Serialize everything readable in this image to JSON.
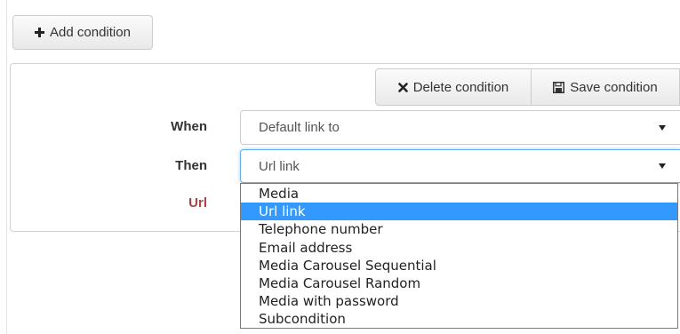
{
  "toolbar": {
    "add_condition_label": "Add condition"
  },
  "condition": {
    "delete_label": "Delete condition",
    "save_label": "Save condition",
    "when": {
      "label": "When",
      "value": "Default link to"
    },
    "then": {
      "label": "Then",
      "value": "Url link",
      "options": [
        "Media",
        "Url link",
        "Telephone number",
        "Email address",
        "Media Carousel Sequential",
        "Media Carousel Random",
        "Media with password",
        "Subcondition"
      ],
      "selected_index": 1
    },
    "url": {
      "label": "Url"
    }
  },
  "colors": {
    "url_label": "#a94442",
    "dropdown_highlight": "#3399ff",
    "focus_border": "#66afe9"
  },
  "icons": {
    "add": "plus-icon",
    "delete": "x-icon",
    "save": "floppy-disk-icon",
    "select": "caret-down-icon"
  }
}
